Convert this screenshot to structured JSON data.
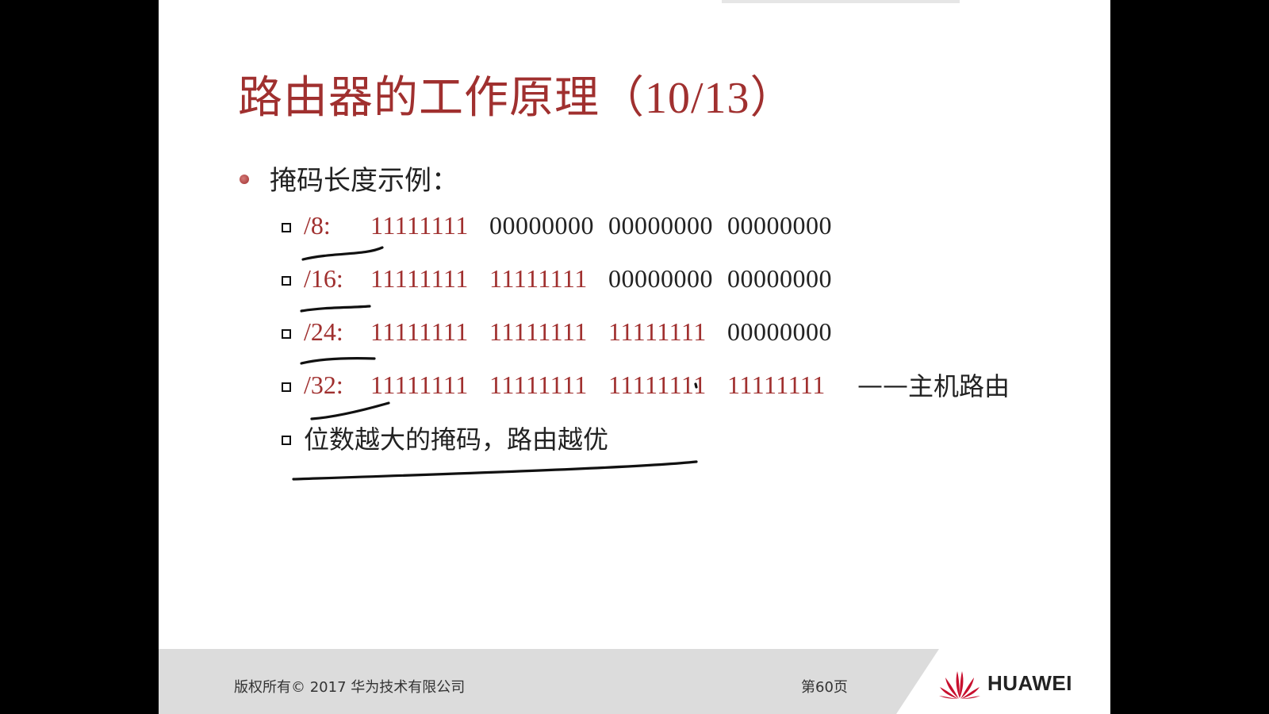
{
  "title": {
    "main": "路由器的工作原理",
    "counter": "（10/13）"
  },
  "heading": "掩码长度示例：",
  "rows": [
    {
      "prefix": "/8:",
      "octets": [
        "11111111",
        "00000000",
        "00000000",
        "00000000"
      ]
    },
    {
      "prefix": "/16:",
      "octets": [
        "11111111",
        "11111111",
        "00000000",
        "00000000"
      ]
    },
    {
      "prefix": "/24:",
      "octets": [
        "11111111",
        "11111111",
        "11111111",
        "00000000"
      ]
    },
    {
      "prefix": "/32:",
      "octets": [
        "11111111",
        "11111111",
        "11111111",
        "11111111"
      ],
      "dash": "——",
      "note": "主机路由"
    }
  ],
  "conclusion": "位数越大的掩码，路由越优",
  "footer": {
    "copyright": "版权所有© 2017 华为技术有限公司",
    "page": "第60页",
    "logo_text": "HUAWEI"
  },
  "colors": {
    "accent": "#a0302f",
    "text": "#222222",
    "footer_bg": "#dcdcdc",
    "logo_red": "#c8102e"
  }
}
